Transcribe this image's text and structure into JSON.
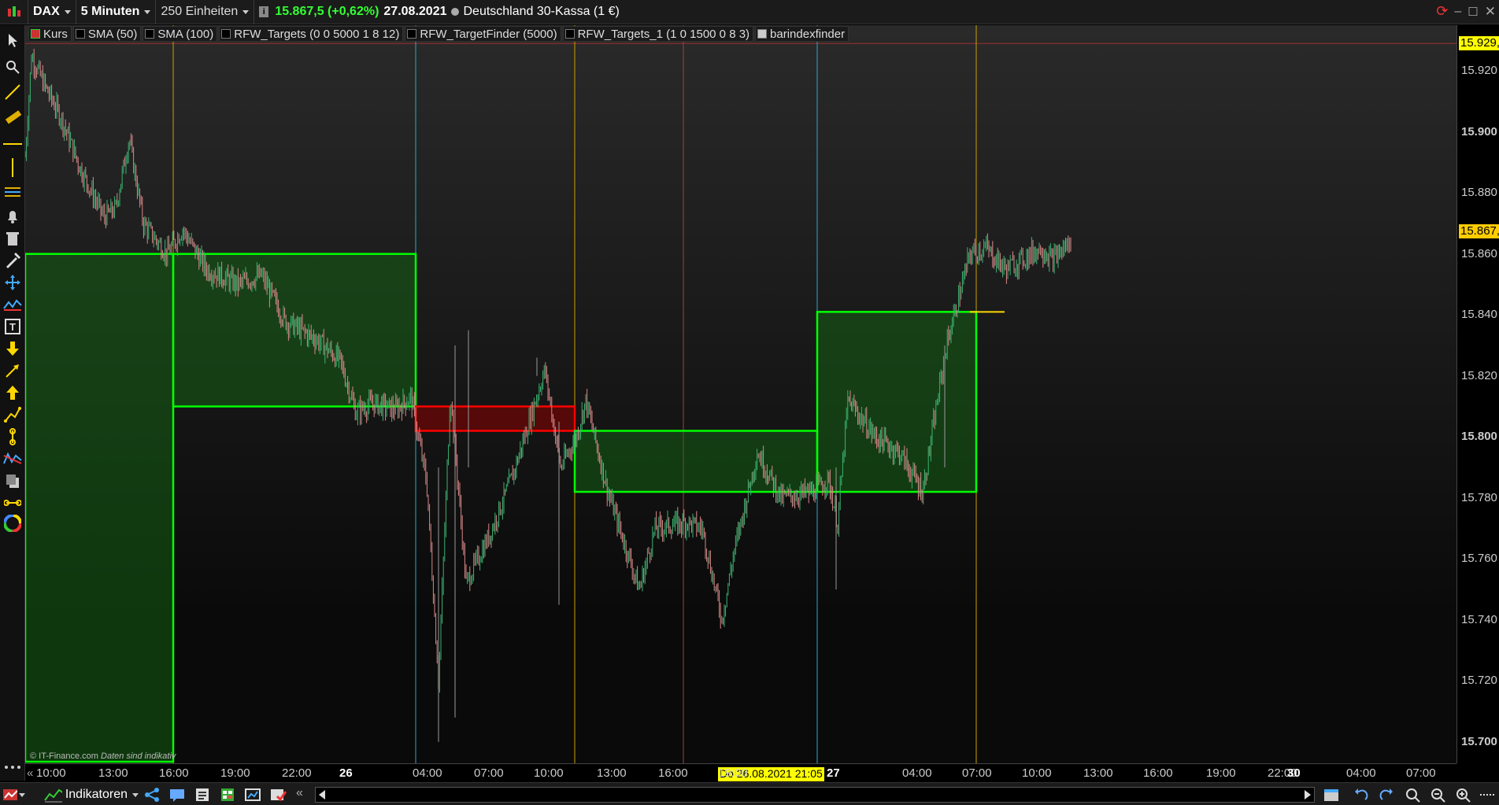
{
  "header": {
    "symbol": "DAX",
    "interval": "5 Minuten",
    "units": "250 Einheiten",
    "price_change": "15.867,5 (+0,62%)",
    "date": "27.08.2021",
    "instrument": "Deutschland 30-Kassa (1 €)"
  },
  "legend": {
    "items": [
      "Kurs",
      "SMA (50)",
      "SMA (100)",
      "RFW_Targets (0 0 5000 1 8 12)",
      "RFW_TargetFinder (5000)",
      "RFW_Targets_1 (1 0 1500 0 8 3)",
      "barindexfinder"
    ]
  },
  "yaxis": {
    "labels": [
      "15.920",
      "15.900",
      "15.880",
      "15.860",
      "15.840",
      "15.820",
      "15.800",
      "15.780",
      "15.760",
      "15.740",
      "15.720",
      "15.700"
    ],
    "bold_labels": [
      "15.900",
      "15.800",
      "15.700"
    ],
    "top_tag": "15.929,",
    "price_tag": "15.867,",
    "top_tag_color": "#ffff00",
    "price_tag_color": "#ffcc00"
  },
  "xaxis": {
    "labels": [
      "10:00",
      "13:00",
      "16:00",
      "19:00",
      "22:00",
      "26",
      "04:00",
      "07:00",
      "10:00",
      "13:00",
      "16:00",
      "19:00",
      "22:00",
      "27",
      "04:00",
      "07:00",
      "10:00",
      "13:00",
      "16:00",
      "19:00",
      "22:00",
      "30",
      "04:00",
      "07:00"
    ],
    "cursor_tag": "Do 26.08.2021 21:05",
    "cursor_tag_visible_suffix": "27"
  },
  "footer": {
    "indicators_label": "Indikatoren",
    "copyright": "© IT-Finance.com",
    "disclaimer": "Daten sind indikativ"
  },
  "chart_data": {
    "type": "candlestick",
    "ylim": [
      15693,
      15935
    ],
    "price_line": 15929,
    "colors": {
      "up": "#3cb371",
      "down": "#d98888",
      "box_green": "#00ff00",
      "box_red": "#ff0000"
    },
    "boxes": [
      {
        "color": "green",
        "top": 15860,
        "bottom": 15693
      },
      {
        "color": "green",
        "top": 15860,
        "bottom": 15810
      },
      {
        "color": "red",
        "top": 15810,
        "bottom": 15802
      },
      {
        "color": "green",
        "top": 15802,
        "bottom": 15782
      },
      {
        "color": "green",
        "top": 15841,
        "bottom": 15782
      }
    ]
  }
}
